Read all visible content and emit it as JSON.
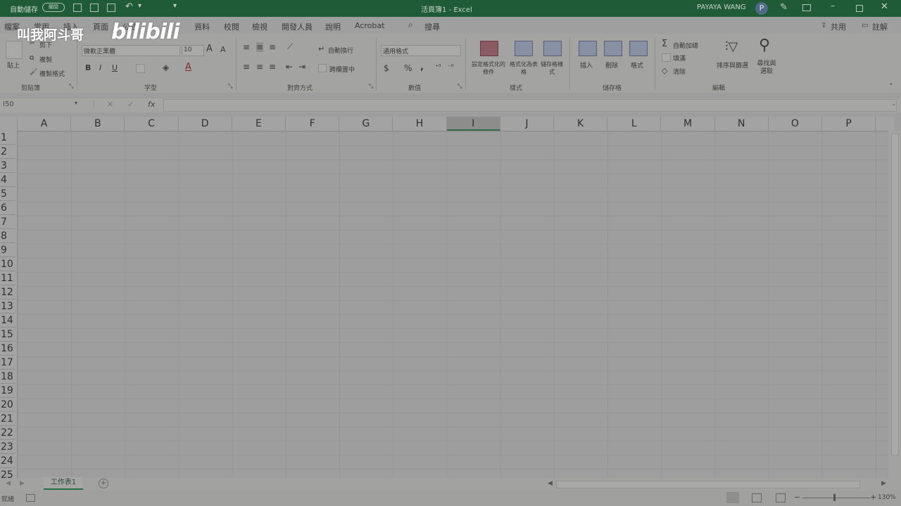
{
  "titlebar": {
    "autosave_label": "自動儲存",
    "autosave_state": "關閉",
    "doc_title": "活頁簿1 - Excel",
    "user_name": "PAYAYA WANG",
    "user_initial": "P"
  },
  "tabs": [
    "檔案",
    "常用",
    "插入",
    "頁面",
    "公式",
    "資料",
    "校閱",
    "檢視",
    "開發人員",
    "說明",
    "Acrobat"
  ],
  "search_label": "搜尋",
  "share_label": "共用",
  "comment_label": "註解",
  "ribbon": {
    "clipboard": {
      "paste": "貼上",
      "cut": "剪下",
      "copy": "複製",
      "format_painter": "複製格式",
      "label": "剪貼簿"
    },
    "font": {
      "name": "微軟正黑體",
      "size": "10",
      "bold": "B",
      "italic": "I",
      "underline": "U",
      "label": "字型",
      "font_color_glyph": "A"
    },
    "alignment": {
      "wrap": "自動換行",
      "merge": "跨欄置中",
      "label": "對齊方式"
    },
    "number": {
      "format": "通用格式",
      "currency": "$",
      "percent": "%",
      "comma": ",",
      "label": "數值"
    },
    "styles": {
      "conditional": "設定格式化的條件",
      "as_table": "格式化為表格",
      "cell_styles": "儲存格樣式",
      "label": "樣式"
    },
    "cells": {
      "insert": "插入",
      "delete": "刪除",
      "format": "格式",
      "label": "儲存格"
    },
    "editing": {
      "autosum": "自動加總",
      "fill": "填滿",
      "clear": "清除",
      "sort_filter": "排序與篩選",
      "find_select": "尋找與選取",
      "label": "編輯"
    }
  },
  "formula_bar": {
    "name_box": "I50",
    "fx": "fx",
    "value": ""
  },
  "columns": [
    "A",
    "B",
    "C",
    "D",
    "E",
    "F",
    "G",
    "H",
    "I",
    "J",
    "K",
    "L",
    "M",
    "N",
    "O",
    "P"
  ],
  "selected_column": "I",
  "rows": [
    "1",
    "2",
    "3",
    "4",
    "5",
    "6",
    "7",
    "8",
    "9",
    "10",
    "11",
    "12",
    "13",
    "14",
    "15",
    "16",
    "17",
    "18",
    "19",
    "20",
    "21",
    "22",
    "23",
    "24",
    "25"
  ],
  "sheet_tab": "工作表1",
  "status": {
    "mode": "就緒",
    "zoom": "130%"
  },
  "watermark": {
    "text": "叫我阿斗哥",
    "logo": "bilibili"
  }
}
